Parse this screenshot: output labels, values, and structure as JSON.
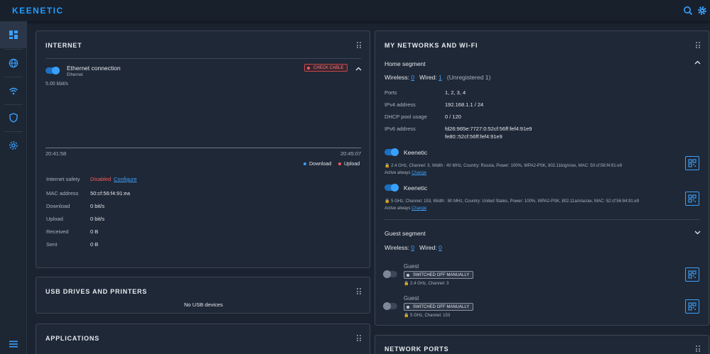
{
  "header": {
    "brand": "KEENETIC"
  },
  "internet": {
    "title": "INTERNET",
    "connection_name": "Ethernet connection",
    "connection_type": "Ethernet",
    "status_badge": "CHECK CABLE",
    "speed": "5.00 kbit/s",
    "time_start": "20:41:58",
    "time_end": "20:45:07",
    "legend_download": "Download",
    "legend_upload": "Upload",
    "rows": [
      {
        "label": "Internet safety",
        "value": "Disabled",
        "link": "Configure"
      },
      {
        "label": "MAC address",
        "value": "50:cf:56:f4:91:ea"
      },
      {
        "label": "Download",
        "value": "0 bit/s"
      },
      {
        "label": "Upload",
        "value": "0 bit/s"
      },
      {
        "label": "Received",
        "value": "0 B"
      },
      {
        "label": "Sent",
        "value": "0 B"
      }
    ],
    "colors": {
      "download": "#3aa0ff",
      "upload": "#ff5a5a"
    }
  },
  "usb": {
    "title": "USB DRIVES AND PRINTERS",
    "empty": "No USB devices"
  },
  "applications": {
    "title": "APPLICATIONS"
  },
  "networks": {
    "title": "MY NETWORKS AND WI-FI",
    "home": {
      "title": "Home segment",
      "wireless_label": "Wireless:",
      "wireless_count": "0",
      "wired_label": "Wired:",
      "wired_count": "1",
      "unregistered": "(Unregistered 1)",
      "rows": [
        {
          "label": "Ports",
          "value": "1, 2, 3, 4"
        },
        {
          "label": "IPv4 address",
          "value": "192.168.1.1 / 24"
        },
        {
          "label": "DHCP pool usage",
          "value": "0 / 120"
        },
        {
          "label": "IPv6 address",
          "value": "fd26:965e:7727:0:52cf:56ff:fef4:91e9",
          "value2": "fe80::52cf:56ff:fef4:91e9"
        }
      ],
      "wifi": [
        {
          "name": "Keenetic",
          "details": "2.4 GHz,  Channel: 3,  Width : 40 MHz,  Country: Russia,  Power: 100%,  WPA2-PSK,  802.11b/g/n/ax,  MAC: 50:cf:56:f4:91:e9",
          "active": "Active always",
          "change": "Change"
        },
        {
          "name": "Keenetic",
          "details": "5 GHz,  Channel: 153,  Width : 80 MHz,  Country: United States,  Power: 100%,  WPA2-PSK,  802.11a/n/ac/ax,  MAC: 52:cf:56:84:91:e9",
          "active": "Active always",
          "change": "Change"
        }
      ]
    },
    "guest": {
      "title": "Guest segment",
      "wireless_label": "Wireless:",
      "wireless_count": "0",
      "wired_label": "Wired:",
      "wired_count": "0",
      "wifi": [
        {
          "name": "Guest",
          "status": "SWITCHED OFF MANUALLY",
          "details": "2.4 GHz,  Channel: 3"
        },
        {
          "name": "Guest",
          "status": "SWITCHED OFF MANUALLY",
          "details": "5 GHz,  Channel: 153"
        }
      ]
    }
  },
  "ports": {
    "title": "NETWORK PORTS"
  }
}
